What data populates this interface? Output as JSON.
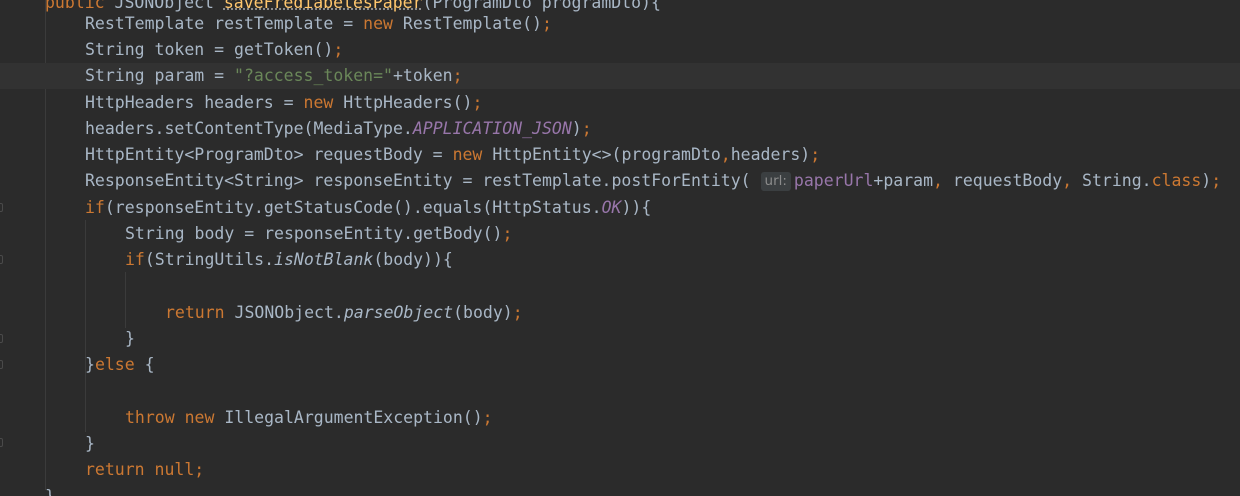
{
  "editor": {
    "colors": {
      "background": "#2b2b2b",
      "current_line": "#323232",
      "keyword": "#cc7832",
      "string": "#6a8759",
      "constant": "#9876aa",
      "method_decl": "#ffc66d",
      "text": "#a9b7c6",
      "hint_bg": "#3b3f41"
    },
    "lines": [
      {
        "id": "sig",
        "tokens": [
          {
            "t": "public ",
            "c": "kw"
          },
          {
            "t": "JSONObject "
          },
          {
            "t": "saveFrediabetesPaper",
            "c": "meth"
          },
          {
            "t": "(ProgramDto programDto){"
          }
        ]
      },
      {
        "id": "l1",
        "tokens": [
          {
            "t": "RestTemplate restTemplate = "
          },
          {
            "t": "new ",
            "c": "kw"
          },
          {
            "t": "RestTemplate()"
          },
          {
            "t": ";",
            "c": "kw"
          }
        ]
      },
      {
        "id": "l2",
        "tokens": [
          {
            "t": "String token = getToken()"
          },
          {
            "t": ";",
            "c": "kw"
          }
        ]
      },
      {
        "id": "l3",
        "tokens": [
          {
            "t": "String param = "
          },
          {
            "t": "\"?access_token=\"",
            "c": "str"
          },
          {
            "t": "+token"
          },
          {
            "t": ";",
            "c": "kw"
          }
        ]
      },
      {
        "id": "l4",
        "tokens": [
          {
            "t": "HttpHeaders headers = "
          },
          {
            "t": "new ",
            "c": "kw"
          },
          {
            "t": "HttpHeaders()"
          },
          {
            "t": ";",
            "c": "kw"
          }
        ]
      },
      {
        "id": "l5",
        "tokens": [
          {
            "t": "headers.setContentType(MediaType."
          },
          {
            "t": "APPLICATION_JSON",
            "c": "const"
          },
          {
            "t": ")"
          },
          {
            "t": ";",
            "c": "kw"
          }
        ]
      },
      {
        "id": "l6",
        "tokens": [
          {
            "t": "HttpEntity<ProgramDto> requestBody = "
          },
          {
            "t": "new ",
            "c": "kw"
          },
          {
            "t": "HttpEntity<>(programDto"
          },
          {
            "t": ",",
            "c": "kw"
          },
          {
            "t": "headers)"
          },
          {
            "t": ";",
            "c": "kw"
          }
        ]
      },
      {
        "id": "l7",
        "tokens": [
          {
            "t": "ResponseEntity<String> responseEntity = restTemplate.postForEntity( "
          },
          {
            "t": "url:",
            "c": "hint"
          },
          {
            "t": "paperUrl",
            "c": "field"
          },
          {
            "t": "+param"
          },
          {
            "t": ", ",
            "c": "kw"
          },
          {
            "t": "requestBody"
          },
          {
            "t": ", ",
            "c": "kw"
          },
          {
            "t": "String."
          },
          {
            "t": "class",
            "c": "kw"
          },
          {
            "t": ")"
          },
          {
            "t": ";",
            "c": "kw"
          }
        ]
      },
      {
        "id": "l8",
        "tokens": [
          {
            "t": "if",
            "c": "kw"
          },
          {
            "t": "(responseEntity.getStatusCode().equals(HttpStatus."
          },
          {
            "t": "OK",
            "c": "const"
          },
          {
            "t": ")){"
          }
        ]
      },
      {
        "id": "l9",
        "tokens": [
          {
            "t": "String body = responseEntity.getBody()"
          },
          {
            "t": ";",
            "c": "kw"
          }
        ]
      },
      {
        "id": "l10",
        "tokens": [
          {
            "t": "if",
            "c": "kw"
          },
          {
            "t": "(StringUtils."
          },
          {
            "t": "isNotBlank",
            "c": "it"
          },
          {
            "t": "(body)){"
          }
        ]
      },
      {
        "id": "l11",
        "tokens": []
      },
      {
        "id": "l12",
        "tokens": [
          {
            "t": "return ",
            "c": "kw"
          },
          {
            "t": "JSONObject."
          },
          {
            "t": "parseObject",
            "c": "it"
          },
          {
            "t": "(body)"
          },
          {
            "t": ";",
            "c": "kw"
          }
        ]
      },
      {
        "id": "l13",
        "tokens": [
          {
            "t": "}"
          }
        ]
      },
      {
        "id": "l14",
        "tokens": [
          {
            "t": "}"
          },
          {
            "t": "else ",
            "c": "kw"
          },
          {
            "t": "{"
          }
        ]
      },
      {
        "id": "l15",
        "tokens": []
      },
      {
        "id": "l16",
        "tokens": [
          {
            "t": "throw ",
            "c": "kw"
          },
          {
            "t": "new ",
            "c": "kw"
          },
          {
            "t": "IllegalArgumentException()"
          },
          {
            "t": ";",
            "c": "kw"
          }
        ]
      },
      {
        "id": "l17",
        "tokens": [
          {
            "t": "}"
          }
        ]
      },
      {
        "id": "l18",
        "tokens": [
          {
            "t": "return null",
            "c": "kw"
          },
          {
            "t": ";",
            "c": "kw"
          }
        ]
      },
      {
        "id": "l19",
        "tokens": [
          {
            "t": "}"
          }
        ]
      }
    ]
  }
}
